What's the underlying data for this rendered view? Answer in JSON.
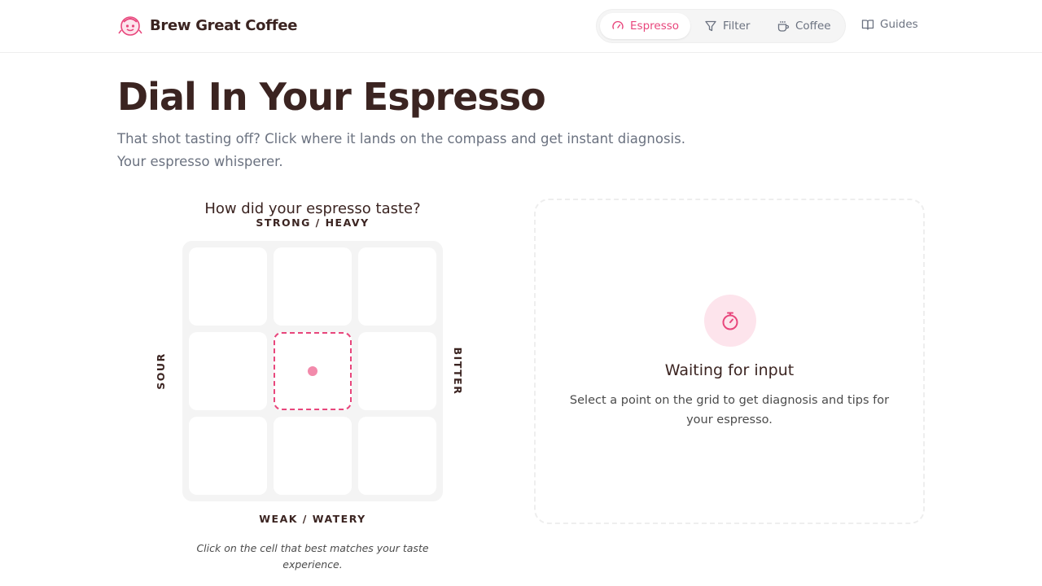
{
  "header": {
    "brand": "Brew Great Coffee",
    "nav": [
      {
        "label": "Espresso",
        "icon": "gauge-icon",
        "active": true
      },
      {
        "label": "Filter",
        "icon": "filter-icon",
        "active": false
      },
      {
        "label": "Coffee",
        "icon": "cup-icon",
        "active": false
      }
    ],
    "guides_label": "Guides"
  },
  "hero": {
    "title": "Dial In Your Espresso",
    "subtitle": "That shot tasting off? Click where it lands on the compass and get instant diagnosis. Your espresso whisperer."
  },
  "grid": {
    "question": "How did your espresso taste?",
    "axis_top": "STRONG / HEAVY",
    "axis_bottom": "WEAK / WATERY",
    "axis_left": "SOUR",
    "axis_right": "BITTER",
    "selected_cell": "middle-center",
    "hint": "Click on the cell that best matches your taste experience."
  },
  "result": {
    "icon": "stopwatch-icon",
    "title": "Waiting for input",
    "description": "Select a point on the grid to get diagnosis and tips for your espresso."
  },
  "colors": {
    "accent": "#e8467c",
    "text_dark": "#3b2421",
    "text_muted": "#6b7280",
    "grid_bg": "#f4f4f4",
    "icon_bg": "#fde4ec"
  }
}
